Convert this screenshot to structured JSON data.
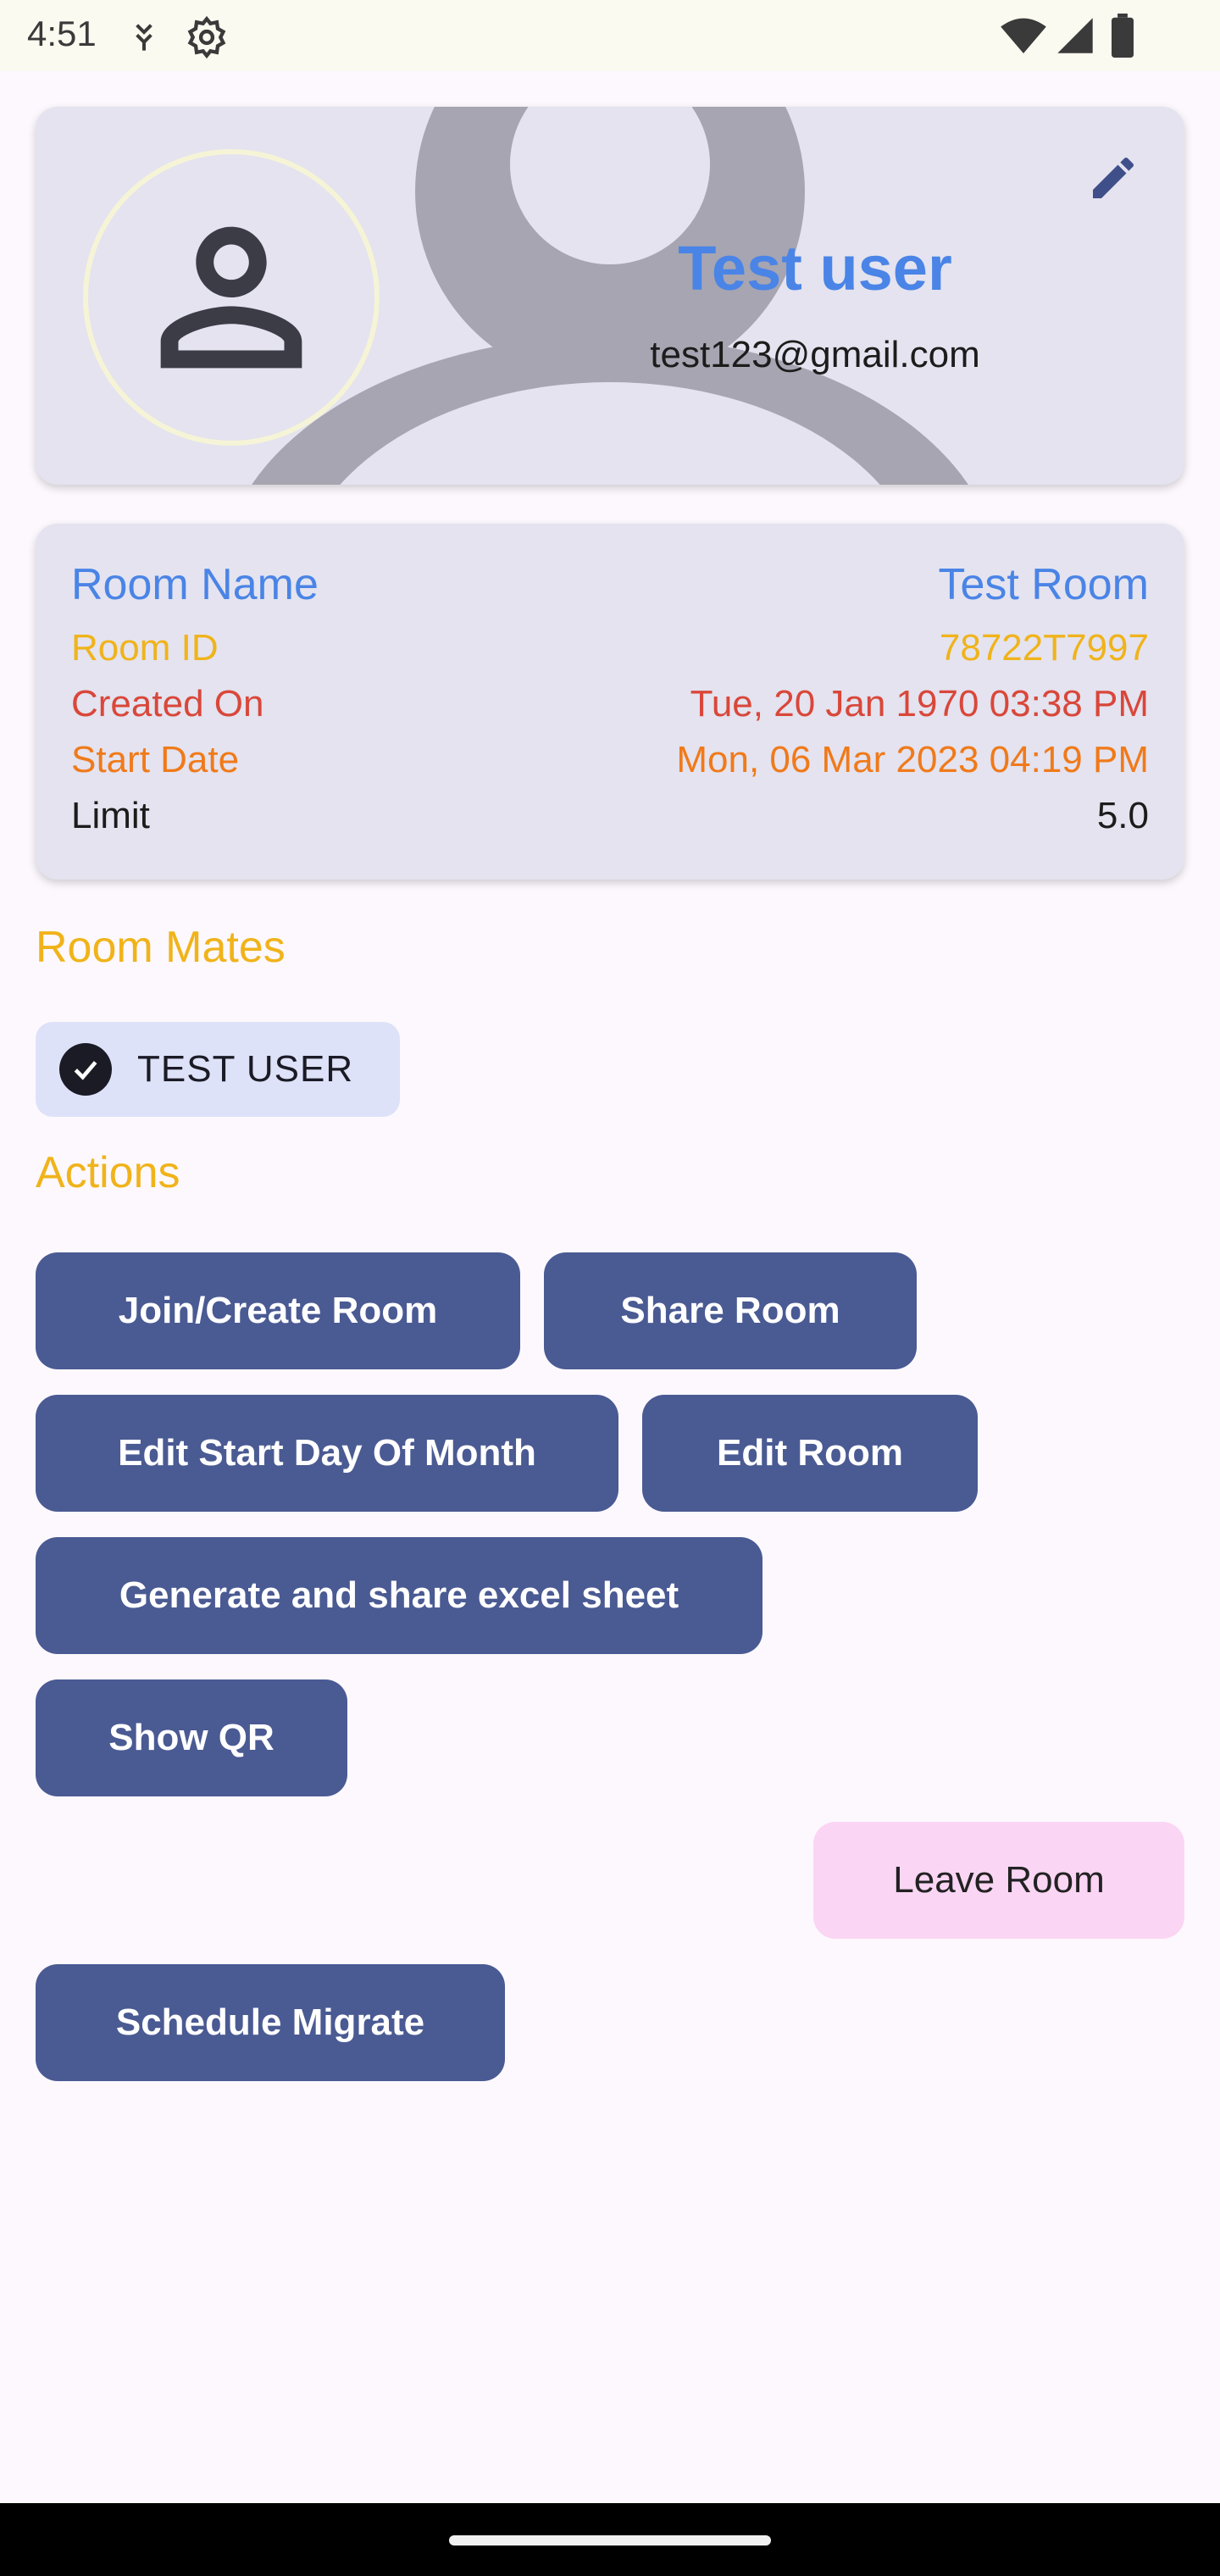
{
  "status_bar": {
    "time": "4:51"
  },
  "profile": {
    "name": "Test user",
    "email": "test123@gmail.com",
    "icons": [
      "person-icon",
      "edit-icon"
    ]
  },
  "room": {
    "rows": [
      {
        "label": "Room Name",
        "value": "Test Room",
        "color": "#4a84e6"
      },
      {
        "label": "Room ID",
        "value": "78722T7997",
        "color": "#f0b31a"
      },
      {
        "label": "Created On",
        "value": "Tue, 20 Jan 1970 03:38 PM",
        "color": "#d9473a"
      },
      {
        "label": "Start Date",
        "value": "Mon, 06 Mar 2023 04:19 PM",
        "color": "#f07a1a"
      },
      {
        "label": "Limit",
        "value": "5.0",
        "color": "#1c1c1c"
      }
    ]
  },
  "room_mates": {
    "title": "Room Mates",
    "members": [
      {
        "name": "TEST USER",
        "selected": true
      }
    ]
  },
  "actions": {
    "title": "Actions",
    "join_create": "Join/Create Room",
    "share": "Share Room",
    "edit_start_day": "Edit Start Day Of Month",
    "edit_room": "Edit Room",
    "generate_excel": "Generate and share excel sheet",
    "show_qr": "Show QR",
    "leave": "Leave Room",
    "schedule_migrate": "Schedule Migrate"
  },
  "colors": {
    "primary_button": "#4a5a93",
    "leave_button": "#fbd5f4",
    "section_title": "#f0b31a",
    "name_blue": "#4a84e6"
  }
}
